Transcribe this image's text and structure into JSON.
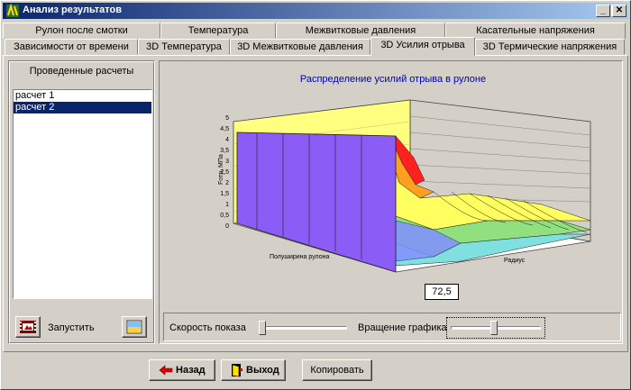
{
  "window": {
    "title": "Анализ результатов"
  },
  "tabs_back": [
    "Рулон после смотки",
    "Температура",
    "Межвитковые давления",
    "Касательные напряжения"
  ],
  "tabs_front": [
    "Зависимости от времени",
    "3D Температура",
    "3D Межвитковые давления",
    "3D Усилия отрыва",
    "3D Термические напряжения"
  ],
  "active_tab": "3D Усилия отрыва",
  "left_panel": {
    "header": "Проведенные расчеты",
    "items": [
      "расчет 1",
      "расчет 2"
    ],
    "selected": "расчет 2",
    "run_label": "Запустить"
  },
  "chart": {
    "title": "Распределение усилий отрыва в рулоне",
    "z_label": "Fотр, МПа",
    "x_label": "Полуширина рулона",
    "y_label": "Радиус",
    "z_ticks": [
      "5",
      "4,5",
      "4",
      "3,5",
      "3",
      "2,5",
      "2",
      "1,5",
      "1",
      "0,5",
      "0"
    ],
    "title_color": "#0000c0",
    "value_box": "72,5"
  },
  "controls": {
    "speed_label": "Скорость показа",
    "rotate_label": "Вращение графика",
    "speed_level": 0.0,
    "rotate_level": 0.48
  },
  "footer": {
    "back_label": "Назад",
    "exit_label": "Выход",
    "copy_label": "Копировать"
  }
}
